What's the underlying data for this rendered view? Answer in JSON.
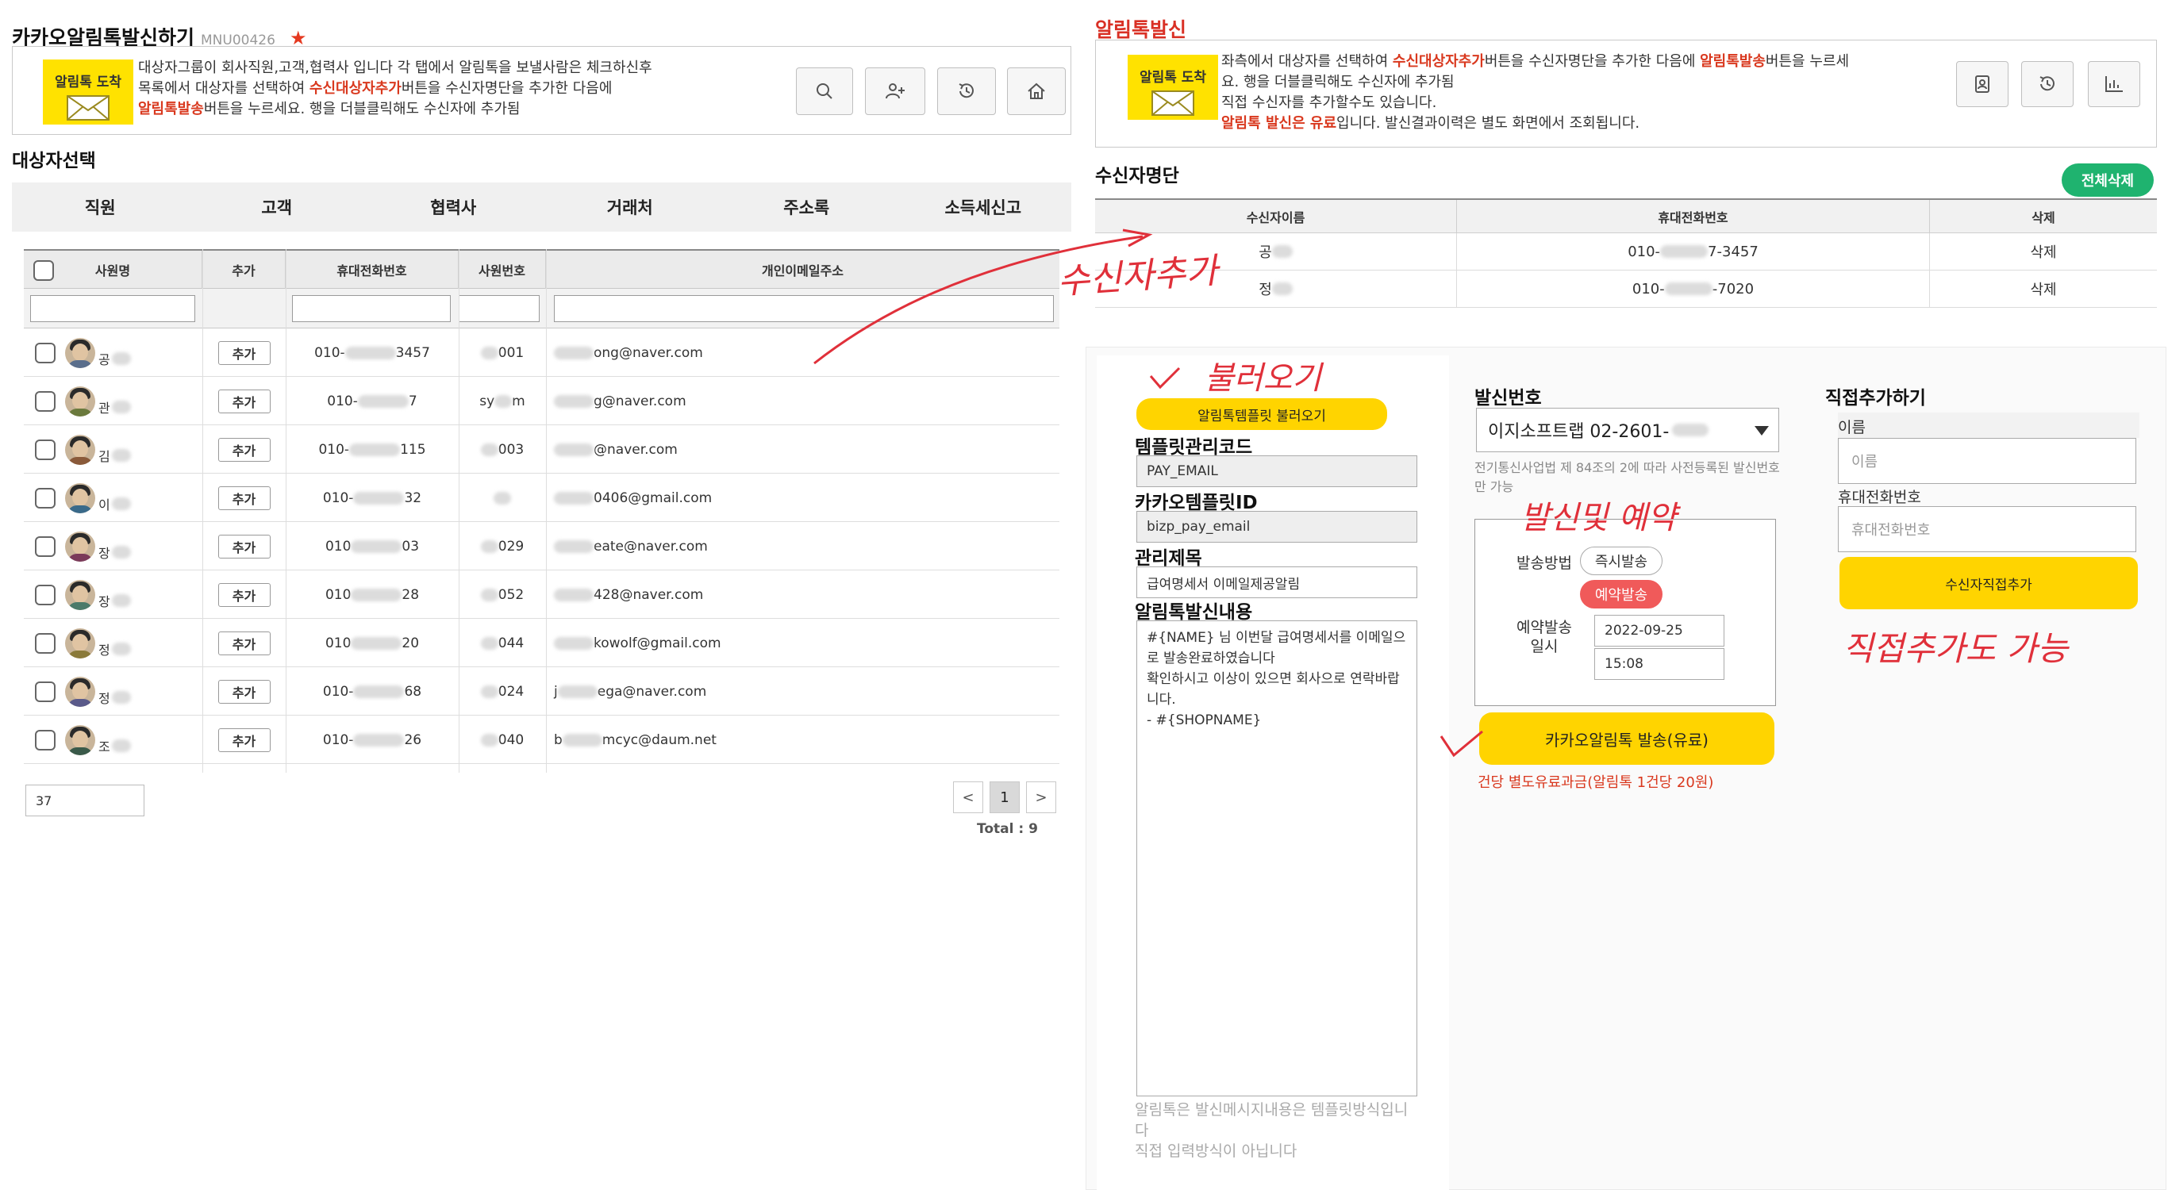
{
  "left_header": {
    "title": "카카오알림톡발신하기",
    "menu_code": "MNU00426",
    "star": "★"
  },
  "left_info": {
    "badge": "알림톡 도착",
    "line1_a": "대상자그룹이 회사직원,고객,협력사 입니다 각 탭에서 알림톡을 보낼사람은 체크하신후",
    "line2_a": "목록에서 대상자를 선택하여 ",
    "line2_hl": "수신대상자추가",
    "line2_b": "버튼을 수신자명단을 추가한 다음에",
    "line3_hl": "알림톡발송",
    "line3_b": "버튼을 누르세요. 행을 더블클릭해도 수신자에 추가됨"
  },
  "left_toolbar": [
    "search-icon",
    "add-user-icon",
    "history-icon",
    "home-icon"
  ],
  "target_select_title": "대상자선택",
  "tabs": [
    "직원",
    "고객",
    "협력사",
    "거래처",
    "주소록",
    "소득세신고"
  ],
  "grid": {
    "columns": [
      "사원명",
      "추가",
      "휴대전화번호",
      "사원번호",
      "개인이메일주소"
    ],
    "add_label": "추가",
    "rows": [
      {
        "name": "공",
        "phone_a": "010-",
        "phone_b": "3457",
        "emp_b": "001",
        "email_b": "ong@naver.com"
      },
      {
        "name": "관",
        "phone_a": "010-",
        "phone_b": "7",
        "emp_a": "sy",
        "emp_b": "m",
        "email_b": "g@naver.com"
      },
      {
        "name": "김",
        "phone_a": "010-",
        "phone_b": "115",
        "emp_b": "003",
        "email_b": "@naver.com"
      },
      {
        "name": "이",
        "phone_a": "010-",
        "phone_b": "32",
        "emp_b": "",
        "email_b": "0406@gmail.com"
      },
      {
        "name": "장",
        "phone_a": "010",
        "phone_b": "03",
        "emp_b": "029",
        "email_b": "eate@naver.com"
      },
      {
        "name": "장",
        "phone_a": "010",
        "phone_b": "28",
        "emp_b": "052",
        "email_b": "428@naver.com"
      },
      {
        "name": "정",
        "phone_a": "010",
        "phone_b": "20",
        "emp_b": "044",
        "email_b": "kowolf@gmail.com"
      },
      {
        "name": "정",
        "phone_a": "010-",
        "phone_b": "68",
        "emp_b": "024",
        "email_a": "j",
        "email_b": "ega@naver.com"
      },
      {
        "name": "조",
        "phone_a": "010-",
        "phone_b": "26",
        "emp_b": "040",
        "email_a": "b",
        "email_b": "mcyc@daum.net"
      }
    ],
    "page_size": "37",
    "pager_prev": "<",
    "pager_current": "1",
    "pager_next": ">",
    "total": "Total : 9"
  },
  "right_header": {
    "title": "알림톡발신"
  },
  "right_info": {
    "badge": "알림톡 도착",
    "line1_a": "좌측에서 대상자를 선택하여 ",
    "line1_hl": "수신대상자추가",
    "line1_b": "버튼을 수신자명단을 추가한 다음에 ",
    "line1_hl2": "알림톡발송",
    "line1_c": "버튼을 누르세",
    "line2": "요. 행을 더블클릭해도 수신자에 추가됨",
    "line3": "직접 수신자를 추가할수도 있습니다.",
    "line4_hl": "알림톡 발신은 유료",
    "line4_b": "입니다. 발신결과이력은 별도 화면에서 조회됩니다."
  },
  "right_toolbar": [
    "contact-card-icon",
    "history-icon",
    "chart-icon"
  ],
  "recipients": {
    "title": "수신자명단",
    "delete_all": "전체삭제",
    "columns": [
      "수신자이름",
      "휴대전화번호",
      "삭제"
    ],
    "rows": [
      {
        "name": "공",
        "phone_a": "010-",
        "phone_b": "7-3457",
        "delete": "삭제"
      },
      {
        "name": "정",
        "phone_a": "010-",
        "phone_b": "-7020",
        "delete": "삭제"
      }
    ]
  },
  "template": {
    "load_button": "알림톡템플릿 불러오기",
    "code_label": "템플릿관리코드",
    "code_value": "PAY_EMAIL",
    "id_label": "카카오템플릿ID",
    "id_value": "bizp_pay_email",
    "subject_label": "관리제목",
    "subject_value": "급여명세서 이메일제공알림",
    "content_label": "알림톡발신내용",
    "content": "#{NAME} 님 이번달 급여명세서를 이메일으로 발송완료하였습니다\n확인하시고 이상이 있으면 회사으로 연락바랍니다.\n- #{SHOPNAME}",
    "note": "알림톡은 발신메시지내용은 템플릿방식입니다\n직접 입력방식이 아닙니다"
  },
  "sender": {
    "label": "발신번호",
    "selected": "이지소프트랩 02-2601-",
    "note": "전기통신사업법 제 84조의 2에 따라 사전등록된 발신번호만 가능",
    "method_label": "발송방법",
    "instant": "즉시발송",
    "reserved": "예약발송",
    "reserve_label_1": "예약발송",
    "reserve_label_2": "일시",
    "reserve_date": "2022-09-25",
    "reserve_time": "15:08",
    "send_button": "카카오알림톡 발송(유료)",
    "fee_note": "건당 별도유료과금(알림톡 1건당 20원)"
  },
  "direct_add": {
    "title": "직접추가하기",
    "name_label": "이름",
    "name_placeholder": "이름",
    "phone_label": "휴대전화번호",
    "phone_placeholder": "휴대전화번호",
    "add_button": "수신자직접추가"
  },
  "annotations": {
    "add_recipient": "수신자추가",
    "load": "불러오기",
    "send_reserve": "발신및 예약",
    "direct_ok": "직접추가도 가능"
  },
  "colors": {
    "accent_red": "#d9381e",
    "yellow": "#ffd400",
    "green": "#1fb36f",
    "handwriting": "#e0303a"
  }
}
